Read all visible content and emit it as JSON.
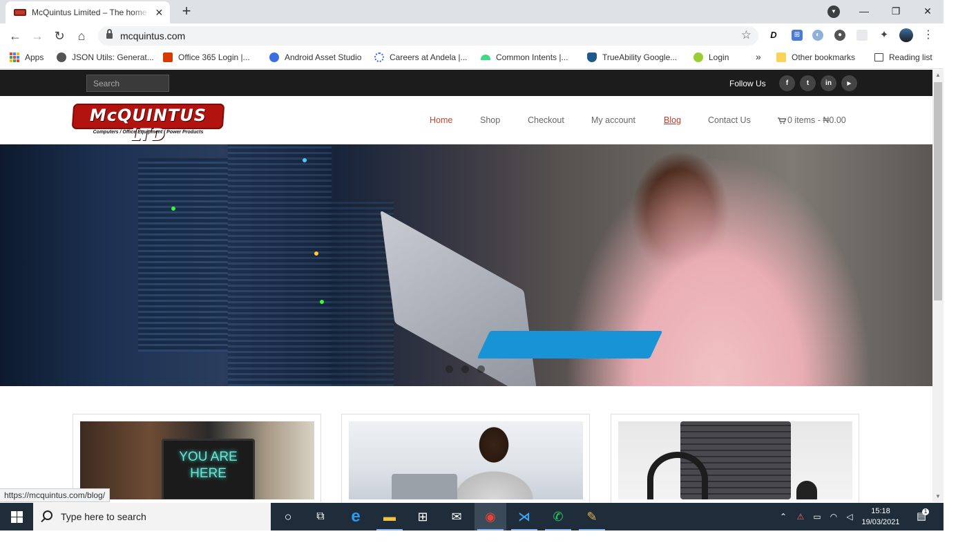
{
  "browser": {
    "tab_title": "McQuintus Limited – The home of",
    "url": "mcquintus.com",
    "window_controls": {
      "minimize": "—",
      "restore": "❐",
      "close": "✕"
    },
    "bookmarks": [
      {
        "label": "Apps",
        "icon": "apps-grid-icon"
      },
      {
        "label": "JSON Utils: Generat...",
        "icon": "globe-icon"
      },
      {
        "label": "Office 365 Login |...",
        "icon": "office-icon"
      },
      {
        "label": "Android Asset Studio",
        "icon": "compass-icon"
      },
      {
        "label": "Careers at Andela |...",
        "icon": "andela-icon"
      },
      {
        "label": "Common Intents |...",
        "icon": "android-icon"
      },
      {
        "label": "TrueAbility Google...",
        "icon": "shield-icon"
      },
      {
        "label": "Login",
        "icon": "login-icon"
      }
    ],
    "bookmarks_overflow": "»",
    "other_bookmarks": "Other bookmarks",
    "reading_list": "Reading list",
    "status_url": "https://mcquintus.com/blog/"
  },
  "site": {
    "search_placeholder": "Search",
    "follow_label": "Follow Us",
    "social": [
      {
        "label": "f",
        "icon": "facebook-icon"
      },
      {
        "label": "t",
        "icon": "twitter-icon"
      },
      {
        "label": "in",
        "icon": "linkedin-icon"
      },
      {
        "label": "▶",
        "icon": "youtube-icon"
      }
    ],
    "logo_text": "McQUINTUS LTD",
    "logo_tagline": "Computers / Office Equipment / Power Products",
    "nav": [
      "Home",
      "Shop",
      "Checkout",
      "My account",
      "Blog",
      "Contact Us"
    ],
    "cart_label": "0 items - ₦0.00",
    "hero_slides": 3,
    "card_neon_text": "YOU ARE HERE",
    "colors": {
      "topbar": "#1c1c1c",
      "accent": "#d0402b",
      "logo_red": "#b3130f"
    }
  },
  "taskbar": {
    "search_text": "Type here to search",
    "time": "15:18",
    "date": "19/03/2021",
    "notification_count": "1",
    "apps": [
      "cortana-icon",
      "task-view-icon",
      "edge-icon",
      "file-explorer-icon",
      "store-icon",
      "mail-icon",
      "chrome-icon",
      "vscode-icon",
      "whatsapp-icon",
      "paint-icon"
    ]
  }
}
